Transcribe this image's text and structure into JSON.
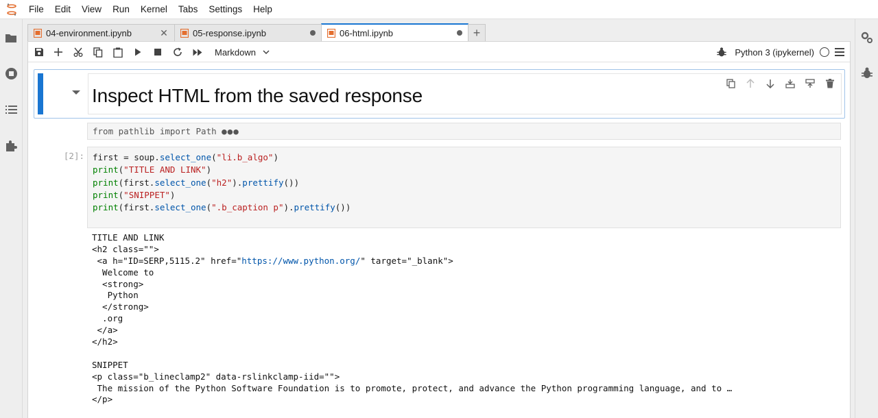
{
  "menu": [
    "File",
    "Edit",
    "View",
    "Run",
    "Kernel",
    "Tabs",
    "Settings",
    "Help"
  ],
  "tabs": [
    {
      "label": "04-environment.ipynb",
      "state": "close"
    },
    {
      "label": "05-response.ipynb",
      "state": "dirty"
    },
    {
      "label": "06-html.ipynb",
      "state": "dirty",
      "active": true
    }
  ],
  "toolbar": {
    "cell_type": "Markdown",
    "kernel_name": "Python 3 (ipykernel)"
  },
  "markdown_cell": {
    "heading": "Inspect HTML from the saved response"
  },
  "collapsed_cell": {
    "text": "from pathlib import Path",
    "ellipsis": "●●●"
  },
  "code_cell": {
    "prompt": "[2]:",
    "lines": [
      "first = soup.select_one(\"li.b_algo\")",
      "print(\"TITLE AND LINK\")",
      "print(first.select_one(\"h2\").prettify())",
      "print(\"SNIPPET\")",
      "print(first.select_one(\".b_caption p\").prettify())"
    ]
  },
  "output_lines": [
    "TITLE AND LINK",
    "<h2 class=\"\">",
    " <a h=\"ID=SERP,5115.2\" href=\"https://www.python.org/\" target=\"_blank\">",
    "  Welcome to",
    "  <strong>",
    "   Python",
    "  </strong>",
    "  .org",
    " </a>",
    "</h2>",
    "",
    "SNIPPET",
    "<p class=\"b_lineclamp2\" data-rslinkclamp-iid=\"\">",
    " The mission of the Python Software Foundation is to promote, protect, and advance the Python programming language, and to …",
    "</p>"
  ],
  "colors": {
    "accent": "#1976d2",
    "notebook_icon": "#e46e2e",
    "string": "#ba2121",
    "builtin": "#008000",
    "attribute": "#0055aa"
  },
  "icons": {
    "left_sidebar": [
      "folder-icon",
      "running-icon",
      "toc-icon",
      "extension-icon"
    ],
    "right_sidebar": [
      "property-inspector-icon",
      "debugger-icon"
    ],
    "toolbar": [
      "save-icon",
      "add-icon",
      "cut-icon",
      "copy-icon",
      "paste-icon",
      "run-icon",
      "stop-icon",
      "restart-icon",
      "fast-forward-icon"
    ],
    "cell_tools": [
      "duplicate-icon",
      "move-up-icon",
      "move-down-icon",
      "insert-above-icon",
      "insert-below-icon",
      "delete-icon"
    ]
  }
}
